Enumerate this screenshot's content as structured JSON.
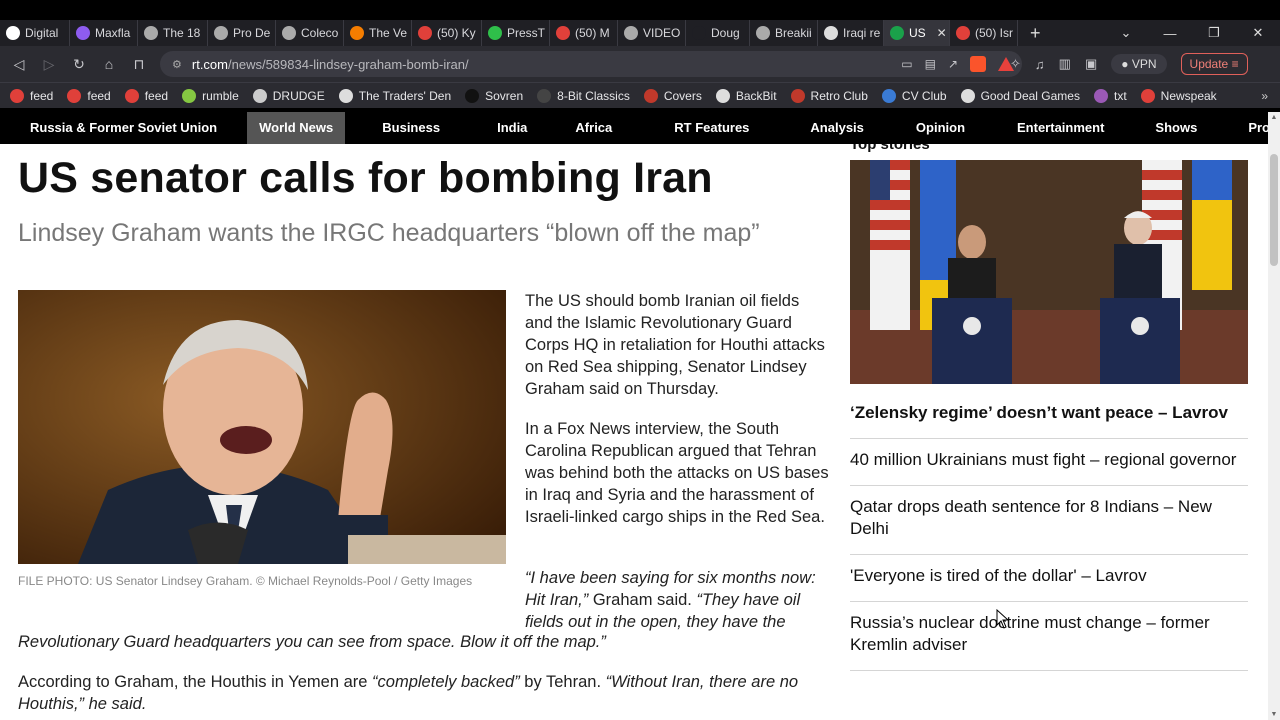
{
  "browser": {
    "tabs": [
      {
        "label": "Digital",
        "icon": "document-icon",
        "color": "#ffffff"
      },
      {
        "label": "Maxfla",
        "icon": "maxfla-icon",
        "color": "#8e5cf0"
      },
      {
        "label": "The 18",
        "icon": "globe-icon",
        "color": "#aaaaaa"
      },
      {
        "label": "Pro De",
        "icon": "globe-icon",
        "color": "#aaaaaa"
      },
      {
        "label": "Coleco",
        "icon": "globe-icon",
        "color": "#aaaaaa"
      },
      {
        "label": "The Ve",
        "icon": "blogger-icon",
        "color": "#f57d00"
      },
      {
        "label": "(50) Ky",
        "icon": "feed-icon",
        "color": "#e0403a"
      },
      {
        "label": "PressT",
        "icon": "play-icon",
        "color": "#2fbf4a"
      },
      {
        "label": "(50) M",
        "icon": "feed-icon",
        "color": "#e0403a"
      },
      {
        "label": "VIDEO",
        "icon": "globe-icon",
        "color": "#aaaaaa"
      },
      {
        "label": "Doug",
        "icon": "blank-icon",
        "color": "#1f1f24"
      },
      {
        "label": "Breakii",
        "icon": "globe-icon",
        "color": "#aaaaaa"
      },
      {
        "label": "Iraqi re",
        "icon": "search-icon",
        "color": "#dddddd"
      },
      {
        "label": "US",
        "icon": "rt-icon",
        "color": "#1aa14a",
        "active": true
      },
      {
        "label": "(50) Isr",
        "icon": "feed-icon",
        "color": "#e0403a"
      }
    ],
    "new_tab": "+",
    "tab_list": "⌄",
    "minimize": "—",
    "restore": "❐",
    "close": "✕",
    "url_host": "rt.com",
    "url_path": "/news/589834-lindsey-graham-bomb-iran/",
    "brave_badge": "14",
    "vpn_label": "VPN",
    "update_label": "Update",
    "bookmarks": [
      {
        "label": "feed",
        "color": "#e0403a"
      },
      {
        "label": "feed",
        "color": "#e0403a"
      },
      {
        "label": "feed",
        "color": "#e0403a"
      },
      {
        "label": "rumble",
        "color": "#85c742"
      },
      {
        "label": "DRUDGE",
        "color": "#cccccc"
      },
      {
        "label": "The Traders' Den",
        "color": "#dddddd"
      },
      {
        "label": "Sovren",
        "color": "#111111"
      },
      {
        "label": "8-Bit Classics",
        "color": "#444444"
      },
      {
        "label": "Covers",
        "color": "#c0392b"
      },
      {
        "label": "BackBit",
        "color": "#dddddd"
      },
      {
        "label": "Retro Club",
        "color": "#c0392b"
      },
      {
        "label": "CV Club",
        "color": "#3a7bd5"
      },
      {
        "label": "Good Deal Games",
        "color": "#dddddd"
      },
      {
        "label": "txt",
        "color": "#9b59b6"
      },
      {
        "label": "Newspeak",
        "color": "#e0403a"
      }
    ],
    "bookmarks_more": "»"
  },
  "rt_nav": {
    "items": [
      {
        "label": "Russia & Former Soviet Union",
        "selected": false
      },
      {
        "label": "World News",
        "selected": true
      },
      {
        "label": "Business",
        "selected": false
      },
      {
        "label": "India",
        "selected": false
      },
      {
        "label": "Africa",
        "selected": false
      },
      {
        "label": "RT Features",
        "selected": false
      },
      {
        "label": "Analysis",
        "selected": false
      },
      {
        "label": "Opinion",
        "selected": false
      },
      {
        "label": "Entertainment",
        "selected": false
      },
      {
        "label": "Shows",
        "selected": false
      },
      {
        "label": "Projects",
        "selected": false
      }
    ]
  },
  "article": {
    "headline": "US senator calls for bombing Iran",
    "subheadline": "Lindsey Graham wants the IRGC headquarters “blown off the map”",
    "caption": "FILE PHOTO: US Senator Lindsey Graham. ©  Michael Reynolds-Pool / Getty Images",
    "para1": "The US should bomb Iranian oil fields and the Islamic Revolutionary Guard Corps HQ in retaliation for Houthi attacks on Red Sea shipping, Senator Lindsey Graham said on Thursday.",
    "para2": "In a Fox News interview, the South Carolina Republican argued that Tehran was behind both the attacks on US bases in Iraq and Syria and the harassment of Israeli-linked cargo ships in the Red Sea.",
    "quote_a": "“I have been saying for six months now: Hit Iran,”",
    "quote_b": " Graham said. ",
    "quote_c": "“They have oil fields out in the open, they have the",
    "quote_d": "Revolutionary Guard headquarters you can see from space. Blow it off the map.”",
    "para4_a": "According to Graham, the Houthis in Yemen are ",
    "para4_b": "“completely backed”",
    "para4_c": " by Tehran. ",
    "para4_d": "“Without Iran, there are no",
    "para4_e": "Houthis,” he said."
  },
  "sidebar": {
    "title": "Top stories",
    "stories": [
      "‘Zelensky regime’ doesn’t want peace – Lavrov",
      "40 million Ukrainians must fight – regional governor",
      "Qatar drops death sentence for 8 Indians – New Delhi",
      "'Everyone is tired of the dollar' – Lavrov",
      "Russia’s nuclear doctrine must change – former Kremlin adviser"
    ]
  }
}
